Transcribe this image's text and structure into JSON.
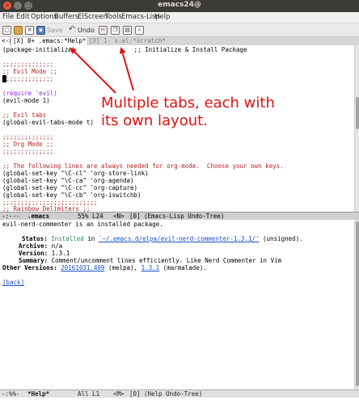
{
  "window": {
    "title": "emacs24@",
    "controls": {
      "close": "×",
      "minimize": "–",
      "maximize": "□"
    }
  },
  "menubar": {
    "items": [
      "File",
      "Edit",
      "Options",
      "Buffers",
      "ElScreen",
      "Tools",
      "Emacs-Lisp",
      "Help"
    ]
  },
  "toolbar": {
    "save_label": "Save",
    "undo_label": "Undo",
    "icons": [
      "new-file-icon",
      "open-folder-icon",
      "close-buffer-icon",
      "save-icon",
      "undo-icon",
      "cut-icon",
      "copy-icon",
      "paste-icon",
      "search-icon"
    ]
  },
  "tabs": {
    "nav": "<->",
    "active": "[X] 0+ .emacs:*Help*",
    "inactive": "[X] 1- x.el:*scratch*"
  },
  "top_buffer": {
    "lines": [
      "(package-initialize)                ;; Initialize & Install Package",
      "",
      ";;;;;;;;;;;;;;",
      ";; Evil Mode ;;",
      ";;;;;;;;;;;;;;",
      "",
      "(require 'evil)",
      "(evil-mode 1)",
      "",
      ";; Evil tabs",
      "(global-evil-tabs-mode t)",
      "",
      ";;;;;;;;;;;;;;",
      ";; Org Mode ;;",
      ";;;;;;;;;;;;;;",
      "",
      ";; The following lines are always needed for org-mode.  Choose your own keys.",
      "(global-set-key \"\\C-cl\" 'org-store-link)",
      "(global-set-key \"\\C-ca\" 'org-agenda)",
      "(global-set-key \"\\C-cc\" 'org-capture)",
      "(global-set-key \"\\C-cb\" 'org-iswitchb)",
      "",
      ";;;;;;;;;;;;;;;;;;;;;;;;;;",
      ";; Rainbow Delimiters ;;"
    ]
  },
  "top_modeline": {
    "flags": "-:---",
    "buffer": ".emacs",
    "position": "55% L24",
    "state": "<N>",
    "depth": "[0]",
    "modes": "(Emacs-Lisp Undo-Tree)"
  },
  "bottom_buffer": {
    "intro": "evil-nerd-commenter is an installed package.",
    "status_label": "Status:",
    "status_value": "Installed",
    "status_in": " in ",
    "status_path": "`~/.emacs.d/elpa/evil-nerd-commenter-1.3.1/'",
    "status_suffix": " (unsigned).",
    "archive_label": "Archive:",
    "archive_value": "n/a",
    "version_label": "Version:",
    "version_value": "1.3.1",
    "summary_label": "Summary:",
    "summary_value": "Comment/uncomment lines efficiently. Like Nerd Commenter in Vim",
    "other_label": "Other Versions:",
    "other_v1": "20161031.409",
    "other_v1_src": " (melpa), ",
    "other_v2": "1.3.1",
    "other_v2_src": " (marmalade).",
    "back": "[back]"
  },
  "bottom_modeline": {
    "flags": "-:%%-",
    "buffer": "*Help*",
    "position": "All L1",
    "state": "<M>",
    "depth": "[0]",
    "modes": "(Help Undo-Tree)"
  },
  "annotation": {
    "text": "Multiple tabs, each with its own layout.",
    "color": "#e01212"
  }
}
